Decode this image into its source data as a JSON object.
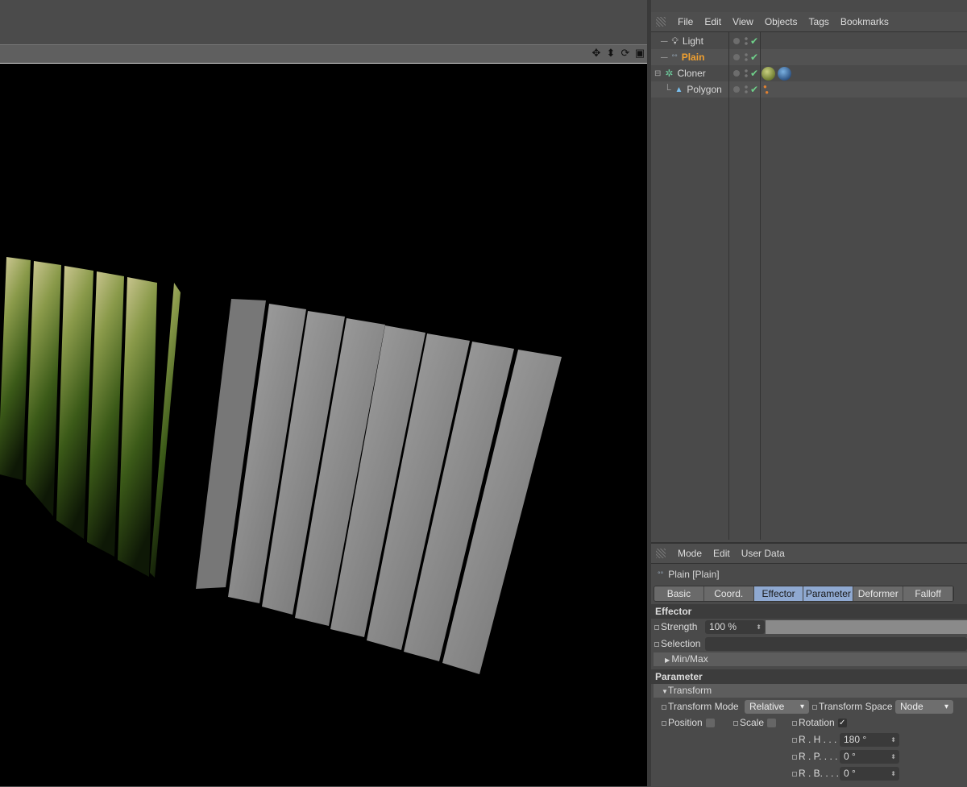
{
  "viewport": {
    "icons": [
      "move-icon",
      "down-arrow-icon",
      "rotate-icon",
      "window-icon"
    ]
  },
  "object_manager": {
    "menu": [
      "File",
      "Edit",
      "View",
      "Objects",
      "Tags",
      "Bookmarks"
    ],
    "objects": [
      {
        "name": "Light",
        "icon": "light-bulb-icon",
        "selected": false
      },
      {
        "name": "Plain",
        "icon": "plain-effector-icon",
        "selected": true,
        "color": "#f0a030"
      },
      {
        "name": "Cloner",
        "icon": "cloner-icon",
        "selected": false,
        "tags": [
          "material-tag-green",
          "material-tag-blue"
        ]
      },
      {
        "name": "Polygon",
        "icon": "polygon-icon",
        "selected": false,
        "tags": [
          "vertex-map-tag"
        ]
      }
    ]
  },
  "attributes": {
    "menu": [
      "Mode",
      "Edit",
      "User Data"
    ],
    "object_title": "Plain [Plain]",
    "tabs": [
      {
        "label": "Basic",
        "active": false
      },
      {
        "label": "Coord.",
        "active": false
      },
      {
        "label": "Effector",
        "active": true
      },
      {
        "label": "Parameter",
        "active": true
      },
      {
        "label": "Deformer",
        "active": false
      },
      {
        "label": "Falloff",
        "active": false
      }
    ],
    "effector_section": "Effector",
    "strength_label": "Strength",
    "strength_value": "100 %",
    "strength_fraction": 1.0,
    "selection_label": "Selection",
    "selection_value": "",
    "minmax_label": "Min/Max",
    "parameter_section": "Parameter",
    "transform_label": "Transform",
    "transform_mode_label": "Transform Mode",
    "transform_mode_value": "Relative",
    "transform_space_label": "Transform Space",
    "transform_space_value": "Node",
    "position_label": "Position",
    "position_checked": false,
    "scale_label": "Scale",
    "scale_checked": false,
    "rotation_label": "Rotation",
    "rotation_checked": true,
    "rh_label": "R . H . . . .",
    "rh_value": "180 °",
    "rp_label": "R . P. . . . .",
    "rp_value": "0 °",
    "rb_label": "R . B. . . . .",
    "rb_value": "0 °"
  }
}
